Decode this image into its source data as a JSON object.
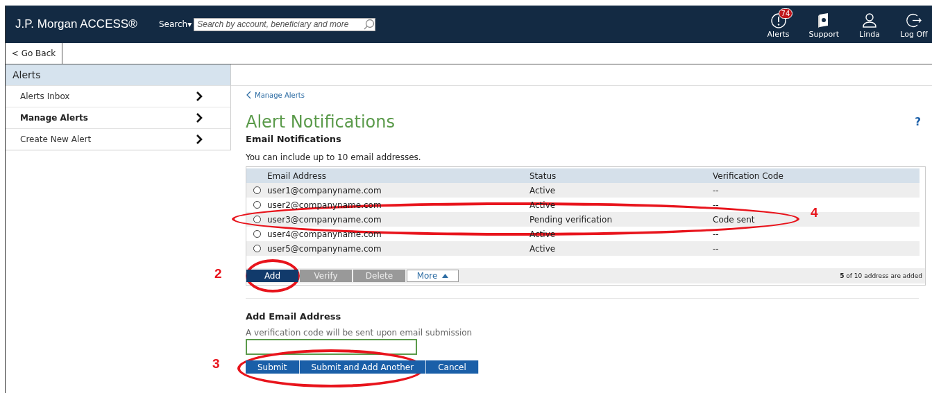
{
  "header": {
    "logo": "J.P. Morgan ACCESS®",
    "search_label": "Search▾",
    "search_placeholder": "Search by account, beneficiary and more",
    "actions": [
      {
        "kind": "alerts",
        "label": "Alerts",
        "badge": "74"
      },
      {
        "kind": "support",
        "label": "Support"
      },
      {
        "kind": "user",
        "label": "Linda"
      },
      {
        "kind": "logoff",
        "label": "Log Off"
      }
    ]
  },
  "go_back": "< Go Back",
  "sidebar": {
    "title": "Alerts",
    "items": [
      {
        "label": "Alerts Inbox",
        "selected": false
      },
      {
        "label": "Manage Alerts",
        "selected": true
      },
      {
        "label": "Create New Alert",
        "selected": false
      }
    ]
  },
  "main": {
    "breadcrumb": "Manage Alerts",
    "title": "Alert Notifications",
    "help": "?",
    "section_title": "Email Notifications",
    "intro": "You can include up to 10 email addresses.",
    "table": {
      "columns": [
        "Email Address",
        "Status",
        "Verification Code"
      ],
      "rows": [
        {
          "email": "user1@companyname.com",
          "status": "Active",
          "code": "--",
          "selected": false
        },
        {
          "email": "user2@companyname.com",
          "status": "Active",
          "code": "--",
          "selected": false
        },
        {
          "email": "user3@companyname.com",
          "status": "Pending verification",
          "code": "Code sent",
          "selected": false
        },
        {
          "email": "user4@companyname.com",
          "status": "Active",
          "code": "--",
          "selected": false
        },
        {
          "email": "user5@companyname.com",
          "status": "Active",
          "code": "--",
          "selected": false
        }
      ]
    },
    "toolbar": [
      {
        "kind": "primary",
        "label": "Add"
      },
      {
        "kind": "disabled",
        "label": "Verify"
      },
      {
        "kind": "disabled",
        "label": "Delete"
      },
      {
        "kind": "menu",
        "label": "More"
      }
    ],
    "count": "**5** of 10 address are added",
    "add_section": {
      "title": "Add Email Address",
      "hint": "A verification code will be sent upon email submission",
      "buttons": [
        "Submit",
        "Submit and Add Another",
        "Cancel"
      ]
    }
  },
  "annotations": [
    {
      "label": "2"
    },
    {
      "label": "3"
    },
    {
      "label": "4"
    }
  ]
}
